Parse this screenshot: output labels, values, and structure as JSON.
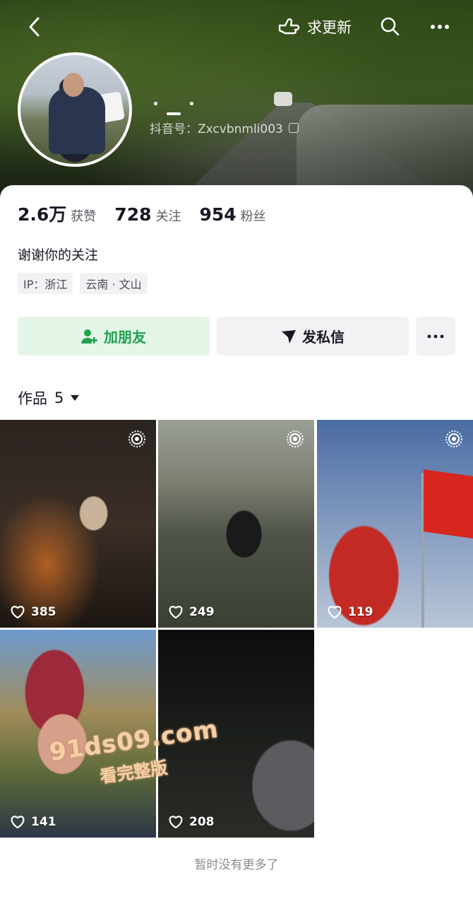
{
  "header": {
    "update_label": "求更新",
    "douyin_id_label": "抖音号：Zxcvbnmli003"
  },
  "profile": {
    "stats": [
      {
        "num": "2.6万",
        "label": "获赞"
      },
      {
        "num": "728",
        "label": "关注"
      },
      {
        "num": "954",
        "label": "粉丝"
      }
    ],
    "bio": "谢谢你的关注",
    "tags": [
      "IP：浙江",
      "云南 · 文山"
    ]
  },
  "actions": {
    "add_friend": "加朋友",
    "message": "发私信"
  },
  "works": {
    "title": "作品",
    "count": "5",
    "items": [
      {
        "likes": "385",
        "live": true
      },
      {
        "likes": "249",
        "live": true
      },
      {
        "likes": "119",
        "live": true
      },
      {
        "likes": "141",
        "live": false
      },
      {
        "likes": "208",
        "live": false
      }
    ]
  },
  "watermark": {
    "line1": "91ds09.com",
    "line2": "看完整版"
  },
  "footer": {
    "no_more": "暂时没有更多了"
  },
  "colors": {
    "accent_green": "#1fa34d",
    "add_friend_bg": "#e3f6e8",
    "button_bg": "#f2f2f4"
  }
}
